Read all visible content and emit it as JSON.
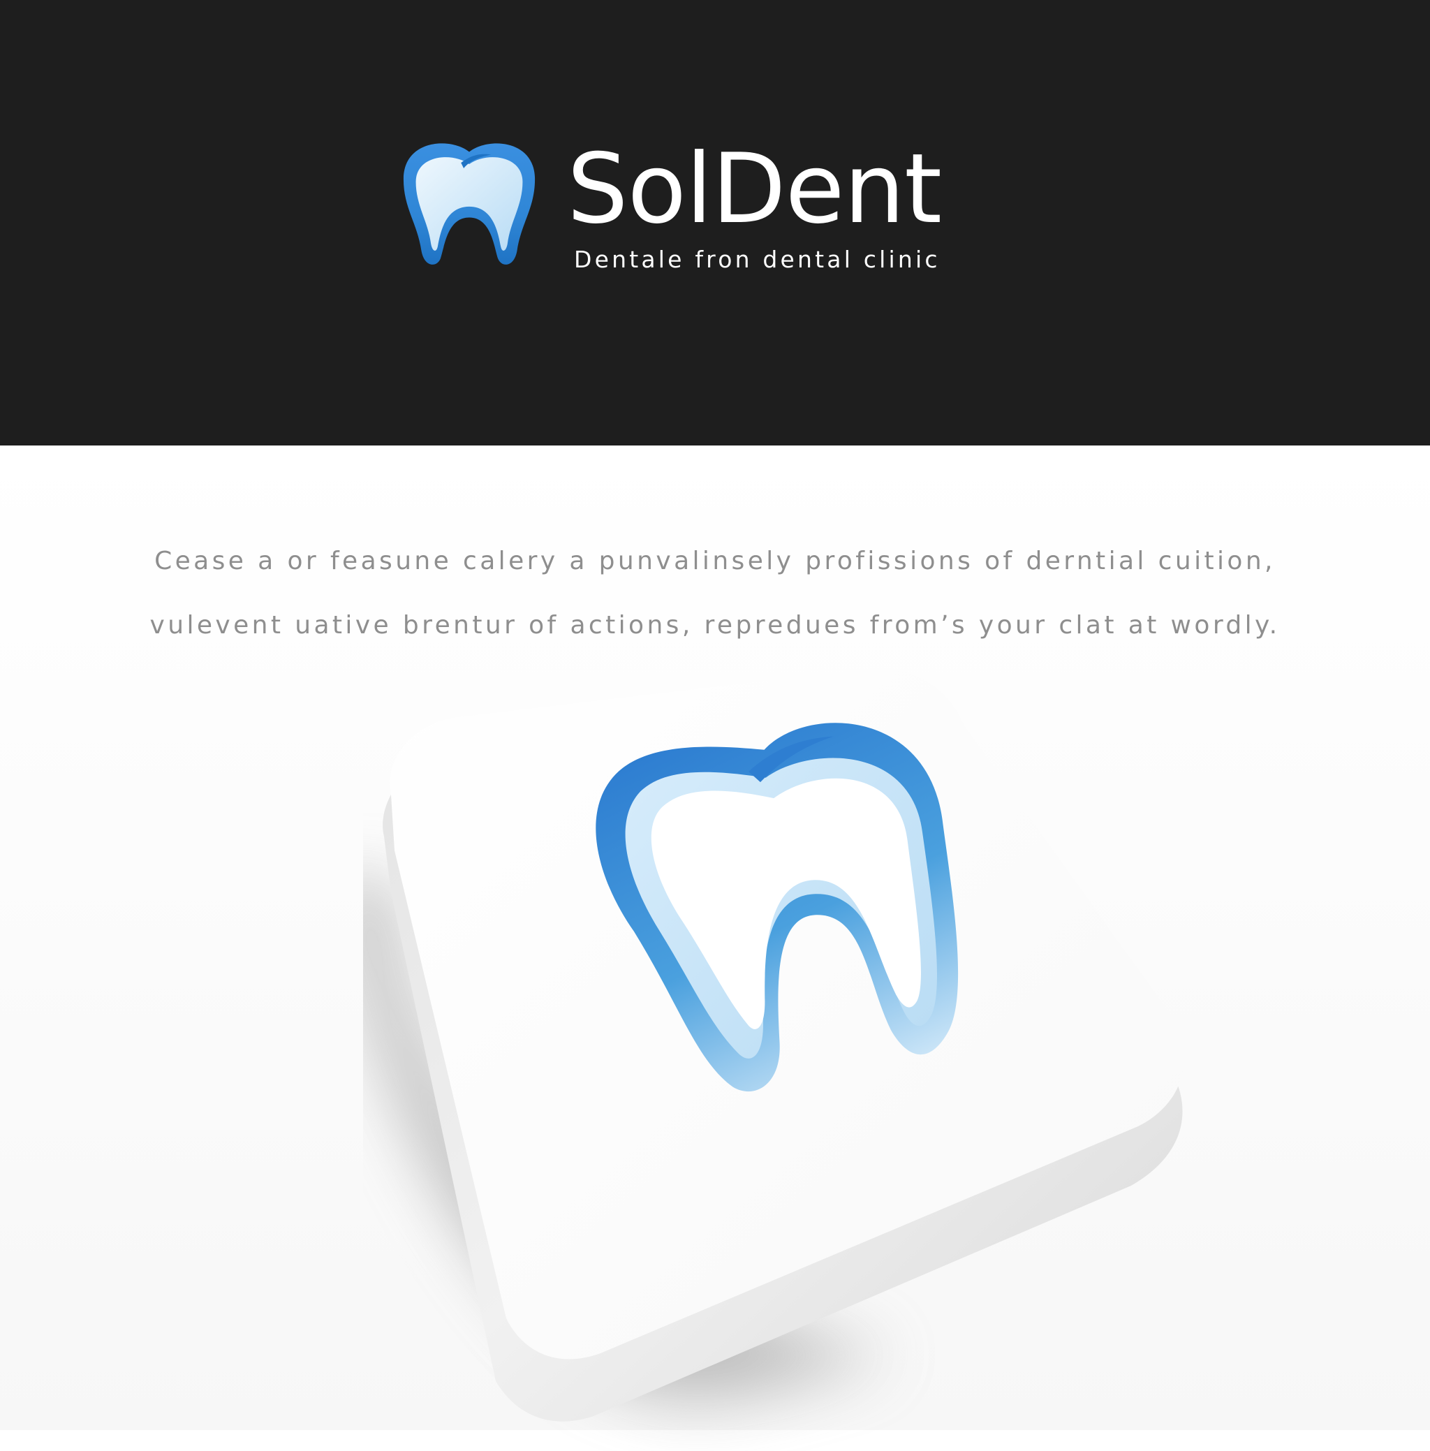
{
  "brand": {
    "name": "SolDent",
    "tagline": "Dentale fron dental clinic",
    "logo_icon": "tooth-icon",
    "colors": {
      "banner_background": "#1e1e1e",
      "brand_text": "#ffffff",
      "tooth_blue_dark": "#2f80d1",
      "tooth_blue_light": "#7fc4ee",
      "tooth_fill": "#e6f3fc"
    }
  },
  "showcase": {
    "description_lines": [
      "Cease a or feasune calery a punvalinsely profissions of derntial cuition,",
      "vulevent uative brentur of actions, repredues from’s your clat at wordly."
    ],
    "description_color": "#8e8e8e",
    "app_tile_icon": "tooth-icon"
  }
}
